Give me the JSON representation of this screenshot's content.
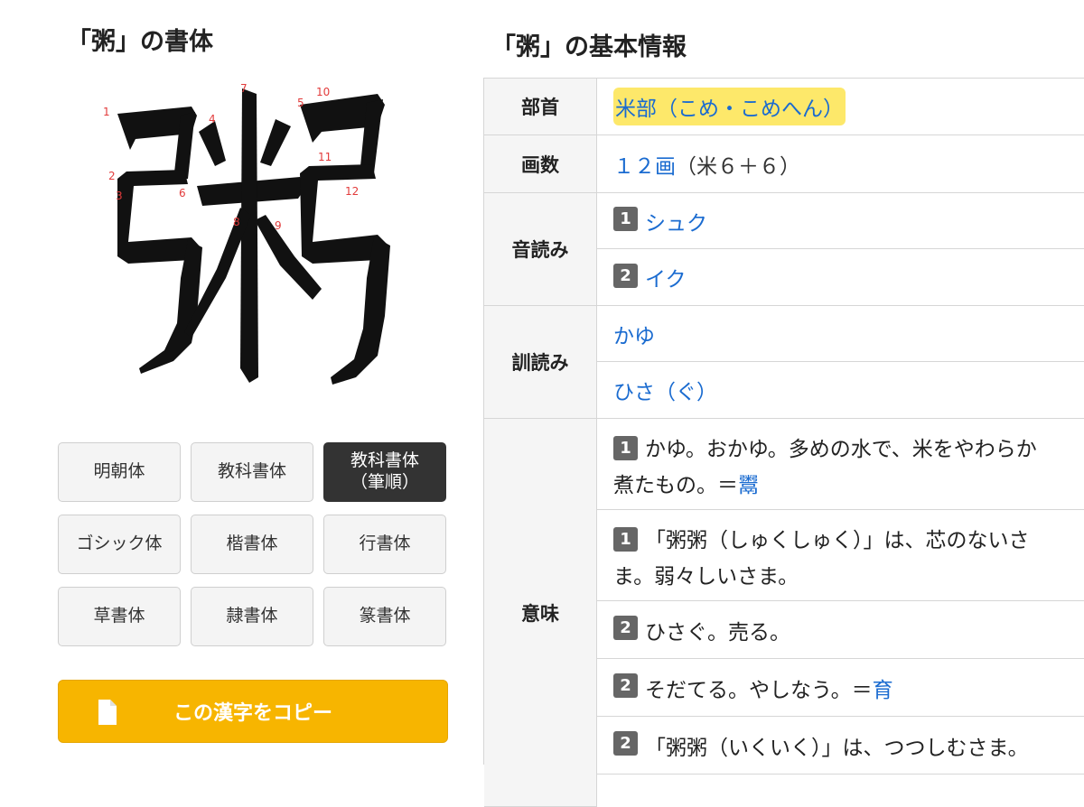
{
  "left": {
    "heading": "「粥」の書体",
    "glyph": {
      "character": "粥",
      "stroke_numbers": [
        "1",
        "2",
        "3",
        "4",
        "5",
        "6",
        "7",
        "8",
        "9",
        "10",
        "11",
        "12"
      ]
    },
    "style_buttons": [
      {
        "label": "明朝体"
      },
      {
        "label": "教科書体"
      },
      {
        "label": "教科書体\n（筆順）",
        "active": true
      },
      {
        "label": "ゴシック体"
      },
      {
        "label": "楷書体"
      },
      {
        "label": "行書体"
      },
      {
        "label": "草書体"
      },
      {
        "label": "隷書体"
      },
      {
        "label": "篆書体"
      }
    ],
    "copy_button": {
      "label": "この漢字をコピー",
      "icon": "document-icon"
    }
  },
  "right": {
    "heading": "「粥」の基本情報",
    "rows": {
      "bushu": {
        "header": "部首",
        "value": "米部（こめ・こめへん）"
      },
      "kakusu": {
        "header": "画数",
        "value_link": "１２画",
        "value_rest": "（米６＋６）"
      },
      "onyomi": {
        "header": "音読み",
        "items": [
          {
            "badge": "1",
            "text": "シュク"
          },
          {
            "badge": "2",
            "text": "イク"
          }
        ]
      },
      "kunyomi": {
        "header": "訓読み",
        "items": [
          {
            "text": "かゆ"
          },
          {
            "text": "ひさ（ぐ）"
          }
        ]
      },
      "imi": {
        "header": "意味",
        "items": [
          {
            "badge": "1",
            "text": "かゆ。おかゆ。多めの水で、米をやわらか",
            "text2": "煮たもの。＝",
            "link": "鬻"
          },
          {
            "badge": "1",
            "text": "「粥粥（しゅくしゅく）」は、芯のないさ",
            "text2": "ま。弱々しいさま。"
          },
          {
            "badge": "2",
            "text": "ひさぐ。売る。"
          },
          {
            "badge": "2",
            "text": "そだてる。やしなう。＝",
            "link": "育"
          },
          {
            "badge": "2",
            "text": "「粥粥（いくいく）」は、つつしむさま。"
          }
        ]
      }
    }
  },
  "colors": {
    "accent_link": "#1a6bd0",
    "copy_button": "#f7b500",
    "highlight": "#fde86a",
    "active_button": "#333333"
  }
}
